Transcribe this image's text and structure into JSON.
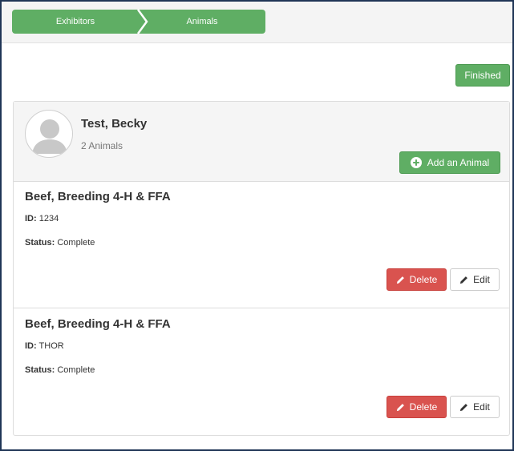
{
  "wizard": {
    "steps": [
      {
        "label": "Exhibitors"
      },
      {
        "label": "Animals"
      }
    ],
    "accent_color": "#5fae64"
  },
  "actions": {
    "finished_label": "Finished"
  },
  "exhibitor": {
    "name": "Test, Becky",
    "animal_count": "2 Animals",
    "add_animal_label": "Add an Animal",
    "avatar_icon": "user-avatar-icon"
  },
  "animals": [
    {
      "title": "Beef, Breeding 4-H & FFA",
      "id_label": "ID:",
      "id_value": "1234",
      "status_label": "Status:",
      "status_value": "Complete",
      "delete_label": "Delete",
      "edit_label": "Edit"
    },
    {
      "title": "Beef, Breeding 4-H & FFA",
      "id_label": "ID:",
      "id_value": "THOR",
      "status_label": "Status:",
      "status_value": "Complete",
      "delete_label": "Delete",
      "edit_label": "Edit"
    }
  ],
  "colors": {
    "success": "#5fae64",
    "danger": "#d9534f",
    "border": "#dcdcdc"
  }
}
